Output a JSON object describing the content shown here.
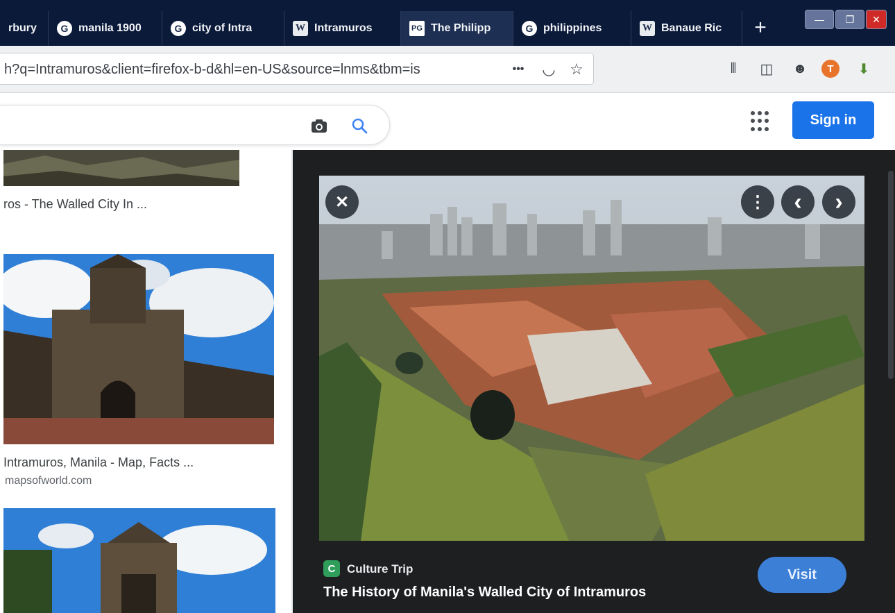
{
  "tabs": [
    {
      "label": "rbury",
      "icon": "none"
    },
    {
      "label": "manila 1900",
      "icon": "google-icon"
    },
    {
      "label": "city of Intra",
      "icon": "google-icon"
    },
    {
      "label": "Intramuros",
      "icon": "wikipedia-icon"
    },
    {
      "label": "The Philipp",
      "icon": "pg-icon"
    },
    {
      "label": "philippines",
      "icon": "google-icon"
    },
    {
      "label": "Banaue Ric",
      "icon": "wikipedia-icon"
    }
  ],
  "favicon_glyphs": {
    "google": "G",
    "wikipedia": "W",
    "pg": "PG"
  },
  "new_tab_glyph": "+",
  "window_controls": {
    "minimize": "—",
    "maximize": "❐",
    "close": "✕"
  },
  "url": "h?q=Intramuros&client=firefox-b-d&hl=en-US&source=lnms&tbm=is",
  "url_actions": {
    "more": "•••",
    "pocket": "◡",
    "bookmark": "☆"
  },
  "toolbar_glyphs": {
    "library": "⦀",
    "sidebar": "◫",
    "account": "☻",
    "ext": "T",
    "extension2": "⬇"
  },
  "google": {
    "signin_label": "Sign in"
  },
  "results": [
    {
      "title": "ros - The Walled City In ...",
      "source": ""
    },
    {
      "title": "Intramuros, Manila - Map, Facts ...",
      "source": "mapsofworld.com"
    }
  ],
  "preview": {
    "source_logo": "C",
    "source_name": "Culture Trip",
    "title": "The History of Manila's Walled City of Intramuros",
    "visit_label": "Visit",
    "close_glyph": "✕",
    "more_glyph": "⋮",
    "prev_glyph": "‹",
    "next_glyph": "›"
  },
  "colors": {
    "tab_bar": "#0c1a3a",
    "signin_button": "#1a73e8",
    "visit_button": "#3b7fd6",
    "preview_bg": "#1d1f21"
  }
}
